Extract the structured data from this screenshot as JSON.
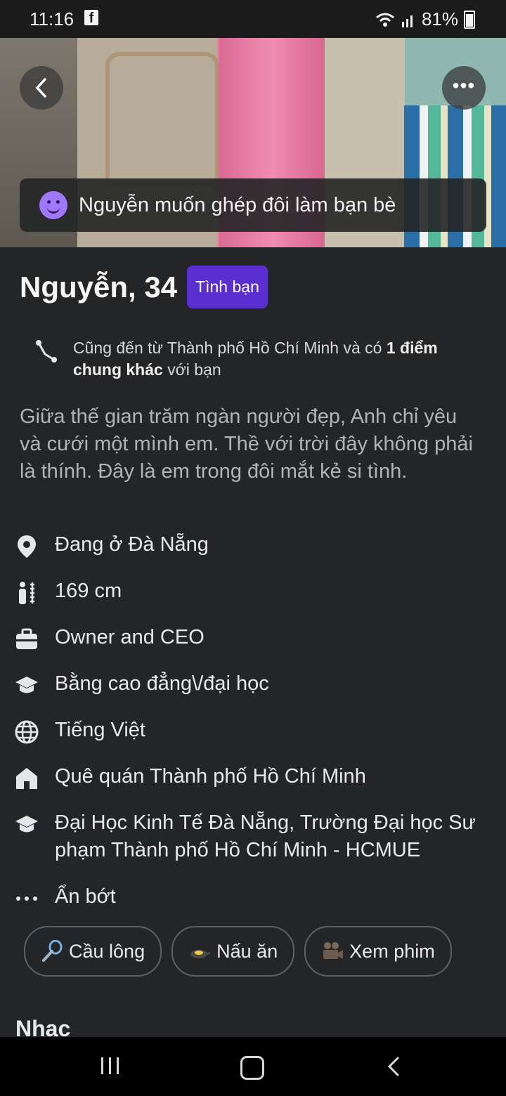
{
  "status": {
    "time": "11:16",
    "app_icon": "facebook-icon",
    "battery": "81%"
  },
  "photo": {
    "back_icon": "chevron-left-icon",
    "more_icon": "more-icon"
  },
  "match_banner": "Nguyễn muốn ghép đôi làm bạn bè",
  "profile": {
    "name_age": "Nguyễn, 34",
    "badge": "Tình bạn"
  },
  "mutual": {
    "prefix": "Cũng đến từ Thành phố Hồ Chí Minh và có ",
    "bold": "1 điểm chung khác",
    "suffix": " với bạn"
  },
  "bio": "Giữa thế gian trăm ngàn người đẹp, Anh chỉ yêu và cưới một mình em. Thề với trời đây không phải là thính. Đây là em trong đôi mắt kẻ si tình.",
  "details": [
    {
      "icon": "location-pin-icon",
      "text": "Đang ở Đà Nẵng"
    },
    {
      "icon": "height-icon",
      "text": "169 cm"
    },
    {
      "icon": "briefcase-icon",
      "text": "Owner and CEO"
    },
    {
      "icon": "graduation-cap-icon",
      "text": "Bằng cao đẳng\\/đại học"
    },
    {
      "icon": "globe-icon",
      "text": "Tiếng Việt"
    },
    {
      "icon": "home-icon",
      "text": "Quê quán Thành phố Hồ Chí Minh"
    },
    {
      "icon": "graduation-cap-icon",
      "text": "Đại Học Kinh Tế Đà Nẵng, Trường Đại học Sư phạm Thành phố Hồ Chí Minh - HCMUE"
    },
    {
      "icon": "more-horizontal-icon",
      "text": "Ẩn bớt"
    }
  ],
  "interests": [
    {
      "icon": "badminton-icon",
      "label": "Cầu lông"
    },
    {
      "icon": "cooking-icon",
      "label": "Nấu ăn"
    },
    {
      "icon": "movie-camera-icon",
      "label": "Xem phim"
    }
  ],
  "section_title": "Nhạc",
  "colors": {
    "background": "#242526",
    "badge": "#5b2ecf",
    "smile": "#a078ff"
  }
}
